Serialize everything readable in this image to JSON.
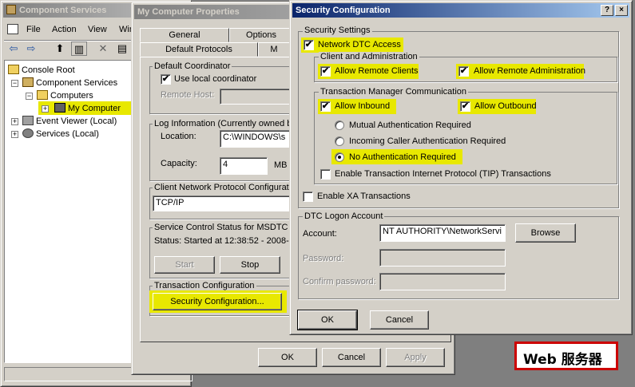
{
  "cs_window": {
    "title": "Component Services",
    "menu": [
      "File",
      "Action",
      "View",
      "Wir"
    ],
    "tree": [
      {
        "label": "Console Root"
      },
      {
        "label": "Component Services"
      },
      {
        "label": "Computers"
      },
      {
        "label": "My Computer"
      },
      {
        "label": "Event Viewer (Local)"
      },
      {
        "label": "Services (Local)"
      }
    ]
  },
  "props_window": {
    "title": "My Computer Properties",
    "tabs": [
      "General",
      "Options",
      "Default Protocols",
      "M"
    ],
    "default_coordinator": {
      "group_label": "Default Coordinator",
      "use_local_label": "Use local coordinator",
      "use_local_checked": true,
      "remote_host_label": "Remote Host:"
    },
    "log_info": {
      "group_label": "Log Information (Currently owned by",
      "location_label": "Location:",
      "location_value": "C:\\WINDOWS\\s",
      "capacity_label": "Capacity:",
      "capacity_value": "4",
      "capacity_unit": "MB"
    },
    "client_network": {
      "group_label": "Client Network Protocol Configurati",
      "value": "TCP/IP"
    },
    "service_control": {
      "group_label": "Service Control Status for MSDTC",
      "status_text": "Status: Started at 12:38:52 - 2008-1",
      "start_label": "Start",
      "stop_label": "Stop"
    },
    "transaction_config": {
      "group_label": "Transaction Configuration",
      "button_label": "Security Configuration..."
    },
    "ok_label": "OK",
    "cancel_label": "Cancel",
    "apply_label": "Apply"
  },
  "security_dialog": {
    "title": "Security Configuration",
    "help_glyph": "?",
    "close_glyph": "×",
    "settings_group_label": "Security Settings",
    "network_dtc_access": {
      "label": "Network DTC Access",
      "checked": true
    },
    "client_admin": {
      "group_label": "Client and Administration",
      "allow_remote_clients": {
        "label": "Allow Remote Clients",
        "checked": true
      },
      "allow_remote_admin": {
        "label": "Allow Remote Administration",
        "checked": true
      }
    },
    "tm_comm": {
      "group_label": "Transaction Manager Communication",
      "allow_inbound": {
        "label": "Allow Inbound",
        "checked": true
      },
      "allow_outbound": {
        "label": "Allow Outbound",
        "checked": true
      },
      "auth_options": [
        {
          "label": "Mutual Authentication Required",
          "selected": false
        },
        {
          "label": "Incoming Caller Authentication Required",
          "selected": false
        },
        {
          "label": "No Authentication Required",
          "selected": true
        }
      ],
      "tip": {
        "label": "Enable Transaction Internet Protocol (TIP) Transactions",
        "checked": false
      }
    },
    "xa": {
      "label": "Enable XA Transactions",
      "checked": false
    },
    "logon": {
      "group_label": "DTC Logon Account",
      "account_label": "Account:",
      "account_value": "NT AUTHORITY\\NetworkServi",
      "browse_label": "Browse",
      "password_label": "Password:",
      "confirm_label": "Confirm password:"
    },
    "ok_label": "OK",
    "cancel_label": "Cancel"
  },
  "callout": {
    "text": "Web 服务器"
  },
  "colors": {
    "highlight": "#e8e800",
    "callout_border": "#cc0000",
    "title_active": "#0a246a"
  }
}
